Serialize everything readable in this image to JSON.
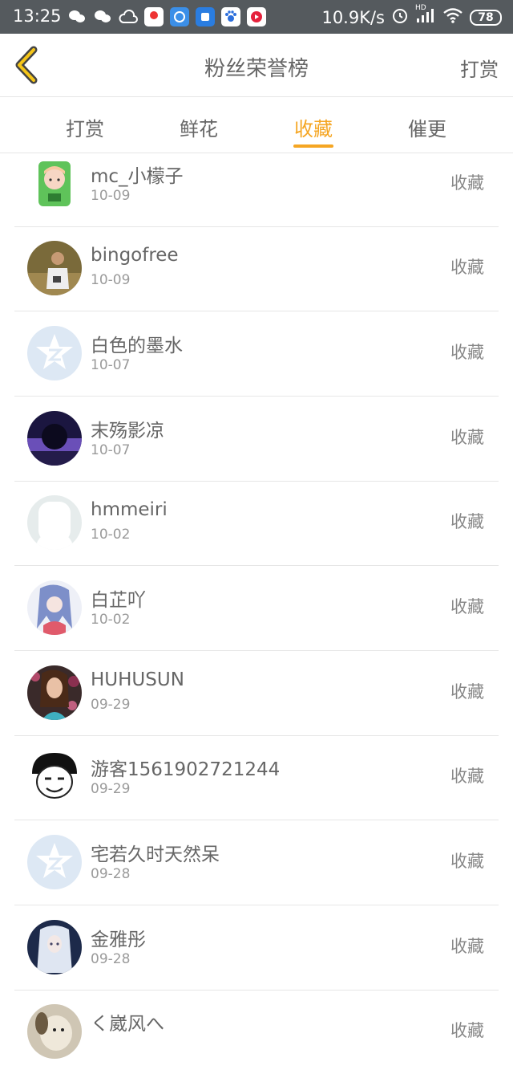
{
  "status_bar": {
    "time": "13:25",
    "speed": "10.9K/s",
    "battery": "78",
    "hd": "HD"
  },
  "header": {
    "title": "粉丝荣誉榜",
    "action": "打赏"
  },
  "tabs": [
    {
      "label": "打赏"
    },
    {
      "label": "鲜花"
    },
    {
      "label": "收藏"
    },
    {
      "label": "催更"
    }
  ],
  "active_tab": "收藏",
  "accent_color": "#f5a623",
  "list": [
    {
      "name": "mc_小檬子",
      "date": "10-09",
      "action": "收藏",
      "avatar_icon": "green-creeper-girl-avatar"
    },
    {
      "name": "bingofree",
      "date": "10-09",
      "action": "收藏",
      "avatar_icon": "photo-man-avatar"
    },
    {
      "name": "白色的墨水",
      "date": "10-07",
      "action": "收藏",
      "avatar_icon": "default-star-avatar"
    },
    {
      "name": "末殇影凉",
      "date": "10-07",
      "action": "收藏",
      "avatar_icon": "purple-eclipse-avatar"
    },
    {
      "name": "hmmeiri",
      "date": "10-02",
      "action": "收藏",
      "avatar_icon": "default-silhouette-avatar"
    },
    {
      "name": "白芷吖",
      "date": "10-02",
      "action": "收藏",
      "avatar_icon": "anime-girl-avatar"
    },
    {
      "name": "HUHUSUN",
      "date": "09-29",
      "action": "收藏",
      "avatar_icon": "portrait-woman-avatar"
    },
    {
      "name": "游客1561902721244",
      "date": "09-29",
      "action": "收藏",
      "avatar_icon": "meme-face-avatar"
    },
    {
      "name": "宅若久时天然呆",
      "date": "09-28",
      "action": "收藏",
      "avatar_icon": "default-star-avatar"
    },
    {
      "name": "金雅彤",
      "date": "09-28",
      "action": "收藏",
      "avatar_icon": "anime-white-hair-avatar"
    },
    {
      "name": "く崴风へ",
      "date": "",
      "action": "收藏",
      "avatar_icon": "dog-avatar"
    }
  ]
}
